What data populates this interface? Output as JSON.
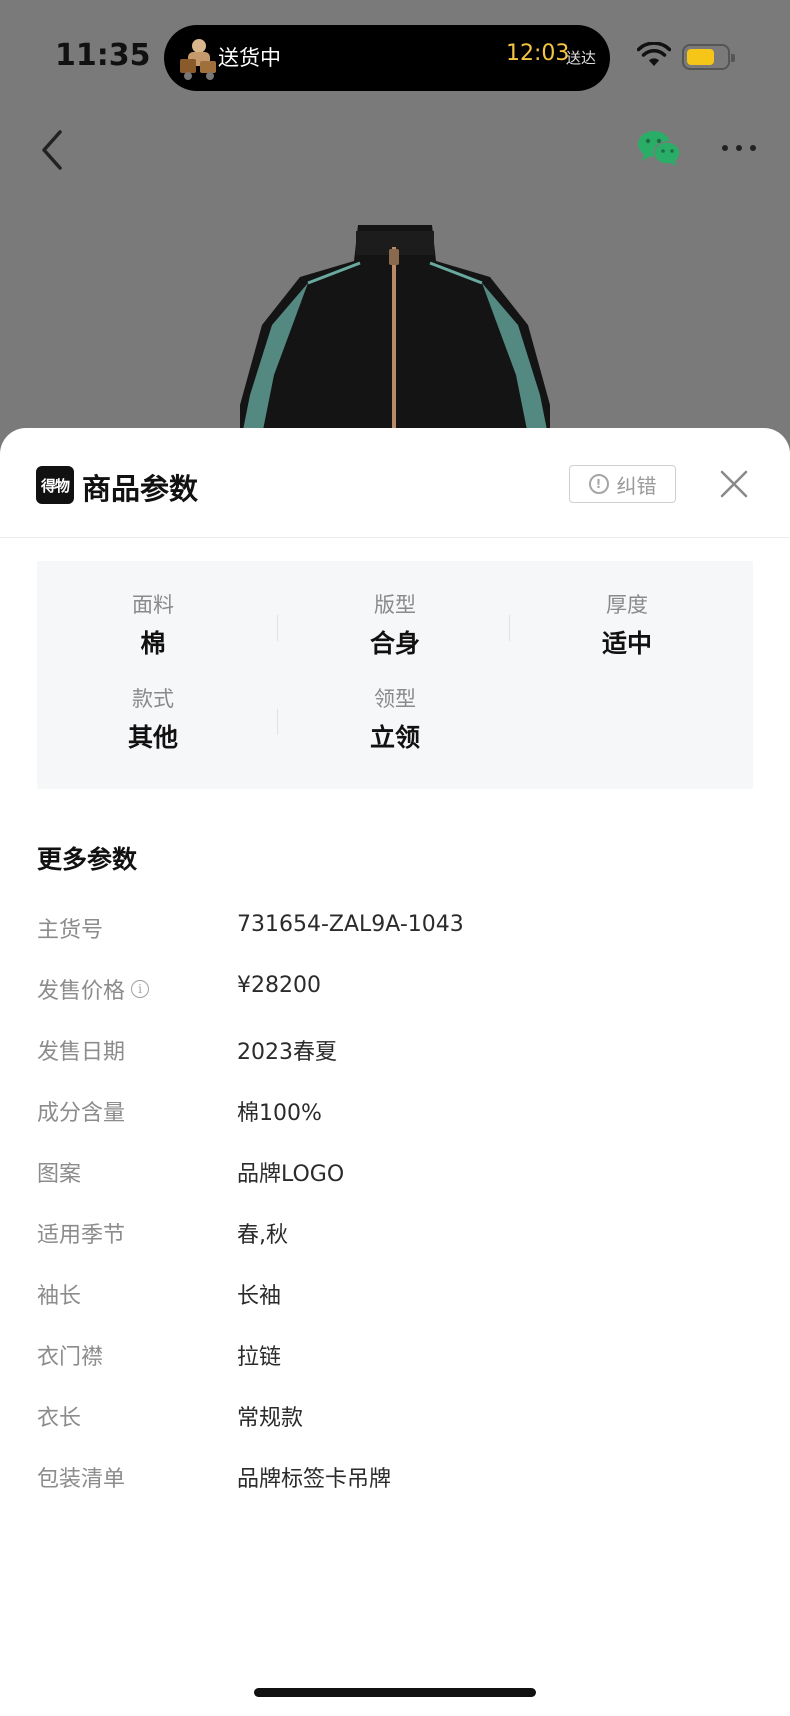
{
  "status_bar": {
    "time": "11:35",
    "live_activity": {
      "label": "送货中",
      "eta": "12:03",
      "eta_suffix": "送达"
    },
    "battery_level": 0.72
  },
  "nav": {
    "back_icon": "chevron-left-icon",
    "share_icon": "wechat-icon",
    "more_icon": "more-dots-icon"
  },
  "sheet": {
    "brand_logo_text": "得物",
    "title": "商品参数",
    "report_label": "纠错",
    "close_icon": "close-icon"
  },
  "specs": [
    {
      "name": "面料",
      "value": "棉"
    },
    {
      "name": "版型",
      "value": "合身"
    },
    {
      "name": "厚度",
      "value": "适中"
    },
    {
      "name": "款式",
      "value": "其他"
    },
    {
      "name": "领型",
      "value": "立领"
    }
  ],
  "more_params": {
    "title": "更多参数",
    "rows": [
      {
        "key": "主货号",
        "value": "731654-ZAL9A-1043"
      },
      {
        "key": "发售价格",
        "value": "¥28200",
        "has_info": true
      },
      {
        "key": "发售日期",
        "value": "2023春夏"
      },
      {
        "key": "成分含量",
        "value": "棉100%"
      },
      {
        "key": "图案",
        "value": "品牌LOGO"
      },
      {
        "key": "适用季节",
        "value": "春,秋"
      },
      {
        "key": "袖长",
        "value": "长袖"
      },
      {
        "key": "衣门襟",
        "value": "拉链"
      },
      {
        "key": "衣长",
        "value": "常规款"
      },
      {
        "key": "包装清单",
        "value": "品牌标签卡吊牌"
      }
    ]
  },
  "colors": {
    "overlay": "#7a7a7a",
    "sheet_bg": "#ffffff",
    "spec_bg": "#f6f7f9",
    "eta_yellow": "#f5c542",
    "wechat_green": "#2aae67"
  }
}
